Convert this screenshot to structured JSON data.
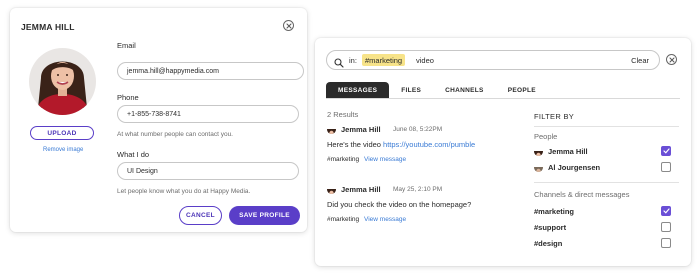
{
  "profile": {
    "title": "JEMMA HILL",
    "upload_label": "UPLOAD",
    "remove_label": "Remove image",
    "email": {
      "label": "Email",
      "value": "jemma.hill@happymedia.com"
    },
    "phone": {
      "label": "Phone",
      "value": "+1-855-738-8741",
      "hint": "At what number people can contact you."
    },
    "role": {
      "label": "What I do",
      "value": "UI Design",
      "hint": "Let people know what you do at Happy Media."
    },
    "cancel_label": "CANCEL",
    "save_label": "SAVE PROFILE"
  },
  "search": {
    "prefix": "in:",
    "token": "#marketing",
    "term": "video",
    "clear_label": "Clear",
    "tabs": [
      {
        "label": "MESSAGES",
        "active": true
      },
      {
        "label": "FILES",
        "active": false
      },
      {
        "label": "CHANNELS",
        "active": false
      },
      {
        "label": "PEOPLE",
        "active": false
      }
    ],
    "results_count": "2 Results",
    "results": [
      {
        "name": "Jemma Hill",
        "time": "June 08, 5:22PM",
        "text": "Here's the video ",
        "link": "https://youtube.com/pumble",
        "channel": "#marketing",
        "view_label": "View message"
      },
      {
        "name": "Jemma Hill",
        "time": "May 25, 2:10 PM",
        "text": "Did you check the video on the homepage?",
        "link": "",
        "channel": "#marketing",
        "view_label": "View message"
      }
    ],
    "filter": {
      "title": "FILTER BY",
      "people_label": "People",
      "people": [
        {
          "name": "Jemma Hill",
          "checked": true
        },
        {
          "name": "Al Jourgensen",
          "checked": false
        }
      ],
      "channels_label": "Channels & direct messages",
      "channels": [
        {
          "name": "#marketing",
          "checked": true
        },
        {
          "name": "#support",
          "checked": false
        },
        {
          "name": "#design",
          "checked": false
        }
      ]
    }
  },
  "colors": {
    "accent": "#5a3ec8",
    "link": "#3a7bd5",
    "token_highlight": "#f7e389",
    "tab_active": "#2b2b2b"
  }
}
